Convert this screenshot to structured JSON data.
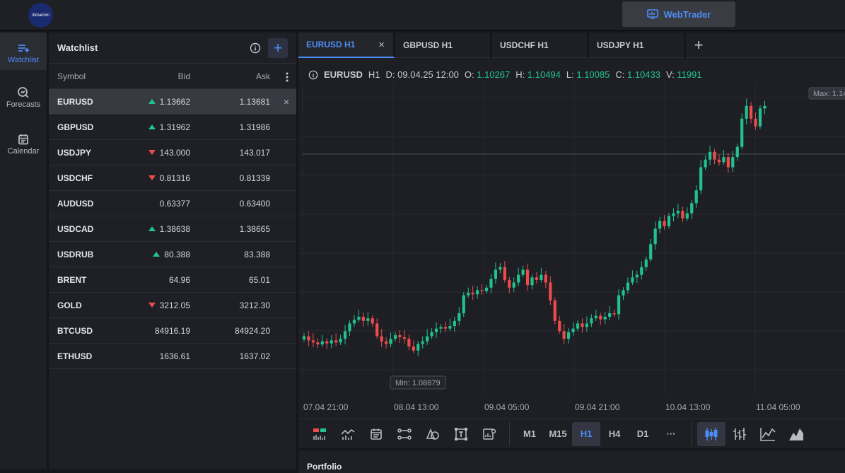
{
  "header": {
    "logo_text": "/binariom",
    "webtrader_label": "WebTrader"
  },
  "rail": [
    {
      "label": "Watchlist",
      "icon": "watchlist-icon",
      "active": true
    },
    {
      "label": "Forecasts",
      "icon": "forecasts-icon",
      "active": false
    },
    {
      "label": "Calendar",
      "icon": "calendar-icon",
      "active": false
    }
  ],
  "watchlist": {
    "title": "Watchlist",
    "columns": {
      "symbol": "Symbol",
      "bid": "Bid",
      "ask": "Ask"
    },
    "rows": [
      {
        "symbol": "EURUSD",
        "bid": "1.13662",
        "ask": "1.13681",
        "dir": "up",
        "selected": true
      },
      {
        "symbol": "GBPUSD",
        "bid": "1.31962",
        "ask": "1.31986",
        "dir": "up"
      },
      {
        "symbol": "USDJPY",
        "bid": "143.000",
        "ask": "143.017",
        "dir": "down"
      },
      {
        "symbol": "USDCHF",
        "bid": "0.81316",
        "ask": "0.81339",
        "dir": "down"
      },
      {
        "symbol": "AUDUSD",
        "bid": "0.63377",
        "ask": "0.63400",
        "dir": "none"
      },
      {
        "symbol": "USDCAD",
        "bid": "1.38638",
        "ask": "1.38665",
        "dir": "up"
      },
      {
        "symbol": "USDRUB",
        "bid": "80.388",
        "ask": "83.388",
        "dir": "up"
      },
      {
        "symbol": "BRENT",
        "bid": "64.96",
        "ask": "65.01",
        "dir": "none"
      },
      {
        "symbol": "GOLD",
        "bid": "3212.05",
        "ask": "3212.30",
        "dir": "down"
      },
      {
        "symbol": "BTCUSD",
        "bid": "84916.19",
        "ask": "84924.20",
        "dir": "none"
      },
      {
        "symbol": "ETHUSD",
        "bid": "1636.61",
        "ask": "1637.02",
        "dir": "none"
      }
    ]
  },
  "tabs": [
    "EURUSD H1",
    "GBPUSD H1",
    "USDCHF H1",
    "USDJPY H1"
  ],
  "legend": {
    "symbol": "EURUSD",
    "tf": "H1",
    "d_label": "D:",
    "d": "09.04.25 12:00",
    "o_label": "O:",
    "o": "1.10267",
    "h_label": "H:",
    "h": "1.10494",
    "l_label": "L:",
    "l": "1.10085",
    "c_label": "C:",
    "c": "1.10433",
    "v_label": "V:",
    "v": "11991"
  },
  "chart": {
    "max_label": "Max: 1.14",
    "min_label": "Min: 1.08879",
    "xticks": [
      "07.04 21:00",
      "08.04 13:00",
      "09.04 05:00",
      "09.04 21:00",
      "10.04 13:00",
      "11.04 05:00"
    ],
    "up_color": "#21c28e",
    "down_color": "#ee4b4b",
    "closes": [
      1.096,
      1.0952,
      1.0948,
      1.0944,
      1.095,
      1.0946,
      1.0952,
      1.0948,
      1.0955,
      1.097,
      1.0985,
      1.0992,
      1.0998,
      1.099,
      1.0995,
      1.0985,
      1.096,
      1.095,
      1.0945,
      1.0955,
      1.0962,
      1.0958,
      1.0955,
      1.094,
      1.0932,
      1.0945,
      1.095,
      1.096,
      1.0968,
      1.0975,
      1.0978,
      1.0975,
      1.098,
      1.099,
      1.1005,
      1.104,
      1.1045,
      1.1042,
      1.105,
      1.1048,
      1.1055,
      1.1072,
      1.109,
      1.1095,
      1.107,
      1.1055,
      1.1065,
      1.108,
      1.109,
      1.106,
      1.1075,
      1.107,
      1.108,
      1.1065,
      1.103,
      1.099,
      1.097,
      1.0955,
      1.0968,
      1.0975,
      1.0985,
      1.0978,
      1.0985,
      1.0995,
      1.1,
      1.0993,
      1.0998,
      1.1005,
      1.1003,
      1.104,
      1.105,
      1.1065,
      1.1075,
      1.108,
      1.1095,
      1.111,
      1.114,
      1.117,
      1.1185,
      1.1175,
      1.1195,
      1.12,
      1.1205,
      1.119,
      1.12,
      1.122,
      1.1245,
      1.129,
      1.1305,
      1.132,
      1.1305,
      1.13,
      1.131,
      1.129,
      1.131,
      1.133,
      1.1385,
      1.141,
      1.1385,
      1.137,
      1.1405,
      1.141
    ],
    "ymin": 1.086,
    "ymax": 1.144
  },
  "toolbar": {
    "timeframes": [
      "M1",
      "M15",
      "H1",
      "H4",
      "D1"
    ],
    "active_timeframe": "H1",
    "more_label": "···"
  },
  "portfolio": {
    "title": "Portfolio"
  }
}
